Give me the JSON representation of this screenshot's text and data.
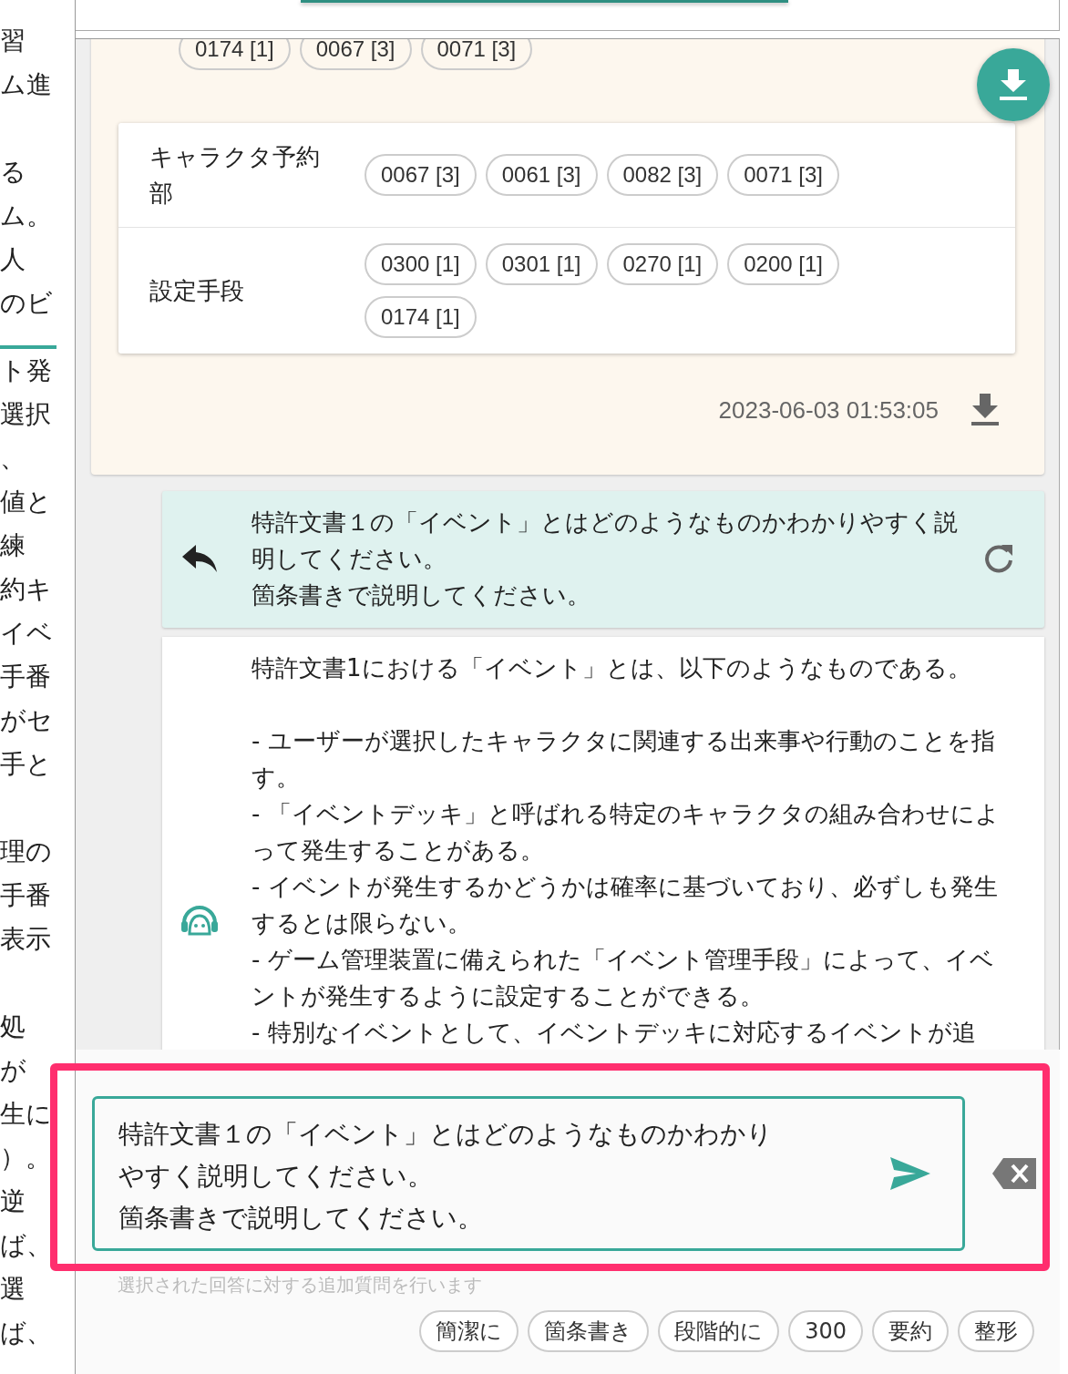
{
  "side_text": {
    "lines": [
      {
        "kind": "text",
        "text": "習"
      },
      {
        "kind": "text",
        "text": "ム進"
      },
      {
        "kind": "gap"
      },
      {
        "kind": "text",
        "text": "る"
      },
      {
        "kind": "text",
        "text": "ム。"
      },
      {
        "kind": "text",
        "text": "人"
      },
      {
        "kind": "text",
        "text": "のビ"
      },
      {
        "kind": "rule"
      },
      {
        "kind": "text",
        "text": "ト発"
      },
      {
        "kind": "text",
        "text": "選択"
      },
      {
        "kind": "text",
        "text": "、"
      },
      {
        "kind": "text",
        "text": "値と"
      },
      {
        "kind": "text",
        "text": "練"
      },
      {
        "kind": "text",
        "text": "約キ"
      },
      {
        "kind": "text",
        "text": "イベ"
      },
      {
        "kind": "text",
        "text": "手番"
      },
      {
        "kind": "text",
        "text": "がセ"
      },
      {
        "kind": "text",
        "text": "手と"
      },
      {
        "kind": "gap"
      },
      {
        "kind": "text",
        "text": "理の"
      },
      {
        "kind": "text",
        "text": "手番"
      },
      {
        "kind": "text",
        "text": "表示"
      },
      {
        "kind": "gap"
      },
      {
        "kind": "text",
        "text": "処"
      },
      {
        "kind": "text",
        "text": "が"
      },
      {
        "kind": "text",
        "text": "生に"
      },
      {
        "kind": "text",
        "text": "）。"
      },
      {
        "kind": "text",
        "text": "逆"
      },
      {
        "kind": "text",
        "text": "ば、"
      },
      {
        "kind": "text",
        "text": "選"
      },
      {
        "kind": "text",
        "text": "ば、"
      }
    ]
  },
  "result_card": {
    "top_chips": [
      "0174 [1]",
      "0067 [3]",
      "0071 [3]"
    ],
    "rows": [
      {
        "label": "キャラクタ予約部",
        "chips": [
          "0067 [3]",
          "0061 [3]",
          "0082 [3]",
          "0071 [3]"
        ]
      },
      {
        "label": "設定手段",
        "chips": [
          "0300 [1]",
          "0301 [1]",
          "0270 [1]",
          "0200 [1]",
          "0174 [1]"
        ]
      }
    ],
    "timestamp": "2023-06-03 01:53:05"
  },
  "question": {
    "lines": [
      "特許文書１の「イベント」とはどのようなものかわかりやすく説明してください。",
      "箇条書きで説明してください。"
    ]
  },
  "answer": {
    "intro": "特許文書1における「イベント」とは、以下のようなものである。",
    "bullets": [
      "- ユーザーが選択したキャラクタに関連する出来事や行動のことを指す。",
      "- 「イベントデッキ」と呼ばれる特定のキャラクタの組み合わせによって発生することがある。",
      "- イベントが発生するかどうかは確率に基づいており、必ずしも発生するとは限らない。",
      "- ゲーム管理装置に備えられた「イベント管理手段」によって、イベントが発生するように設定することができる。",
      "- 特別なイベントとして、イベントデッキに対応するイベントが追"
    ]
  },
  "composer": {
    "value_lines": [
      "特許文書１の「イベント」とはどのようなものかわかりやすく説明してください。",
      "箇条書きで説明してください。"
    ],
    "hint": "選択された回答に対する追加質問を行います",
    "quick_chips": [
      "簡潔に",
      "箇条書き",
      "段階的に",
      "300",
      "要約",
      "整形"
    ]
  }
}
